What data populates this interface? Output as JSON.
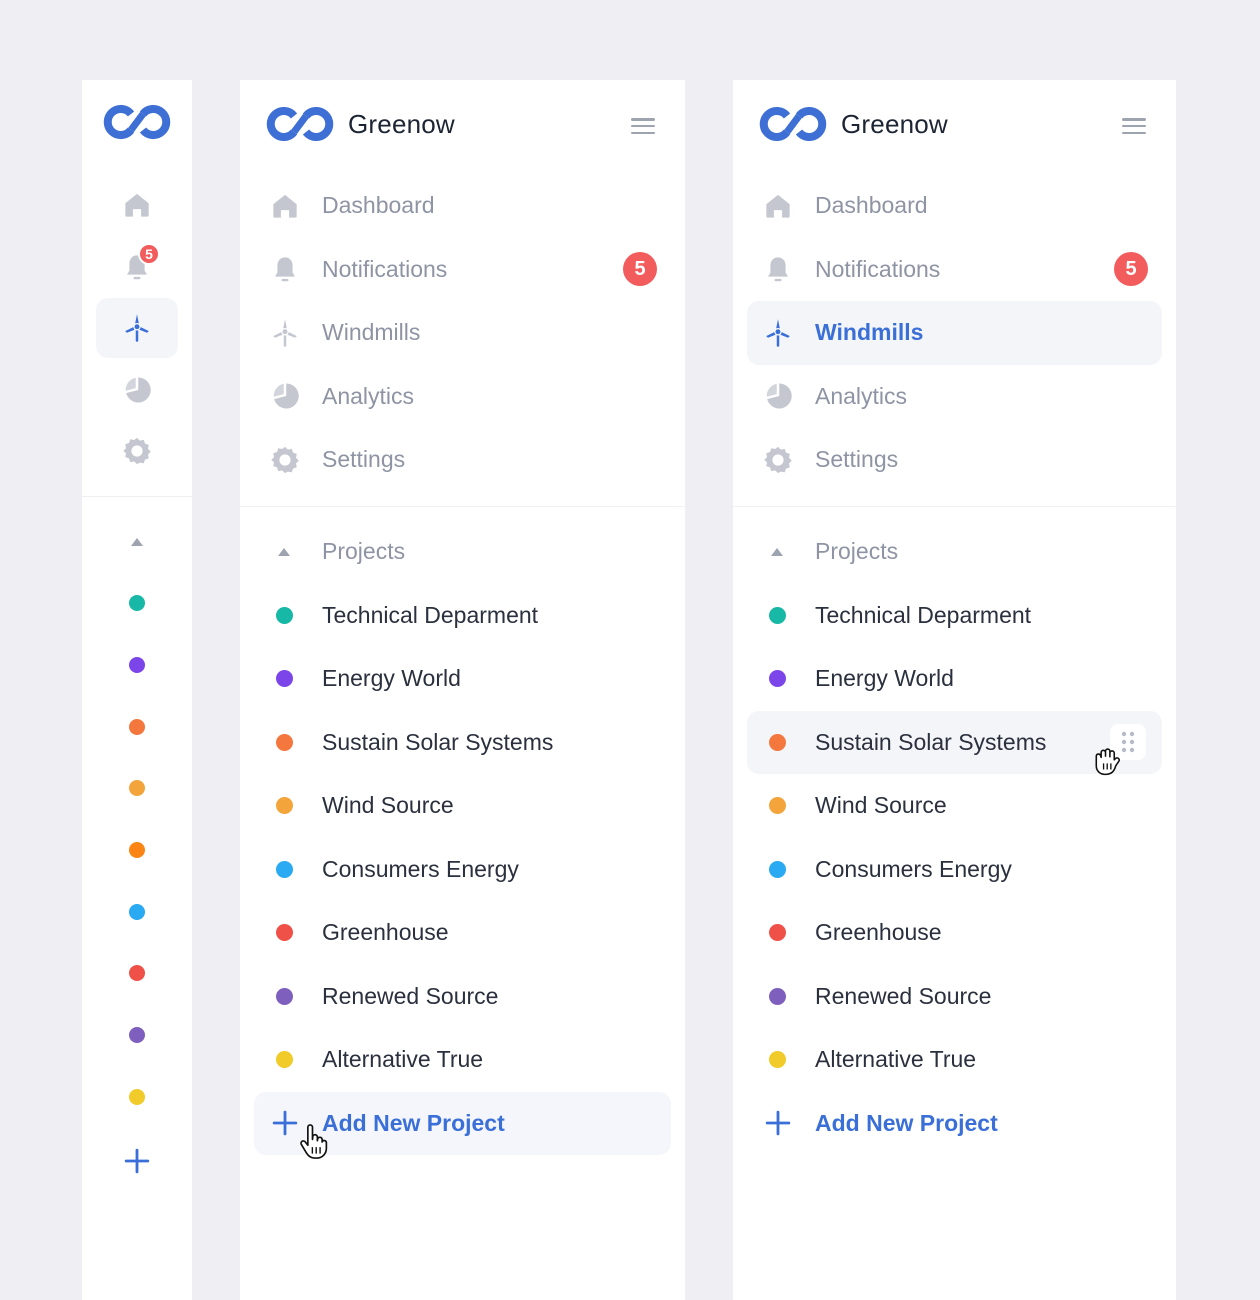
{
  "brand": {
    "name": "Greenow",
    "logo_icon": "infinity-logo-icon"
  },
  "colors": {
    "accent": "#3b6fd8",
    "badge": "#f25c5c",
    "icon_inactive": "#c4c7d0",
    "text_muted": "#8e94a3",
    "text_dark": "#2a303d"
  },
  "menu": {
    "icon": "hamburger-menu-icon"
  },
  "nav": [
    {
      "key": "dashboard",
      "label": "Dashboard",
      "icon": "home-icon"
    },
    {
      "key": "notifications",
      "label": "Notifications",
      "icon": "bell-icon",
      "badge": "5"
    },
    {
      "key": "windmills",
      "label": "Windmills",
      "icon": "windmill-icon"
    },
    {
      "key": "analytics",
      "label": "Analytics",
      "icon": "pie-chart-icon"
    },
    {
      "key": "settings",
      "label": "Settings",
      "icon": "gear-icon"
    }
  ],
  "projects": {
    "header": "Projects",
    "items": [
      {
        "label": "Technical Deparment",
        "color": "#17b8a6"
      },
      {
        "label": "Energy World",
        "color": "#7c45ea"
      },
      {
        "label": "Sustain Solar Systems",
        "color": "#f4773e"
      },
      {
        "label": "Wind Source",
        "color": "#f3a53c"
      },
      {
        "label": "Consumers Energy",
        "color": "#2aaaf2"
      },
      {
        "label": "Greenhouse",
        "color": "#ef5148"
      },
      {
        "label": "Renewed Source",
        "color": "#7f5fbd"
      },
      {
        "label": "Alternative True",
        "color": "#f0cb2a"
      }
    ],
    "add_label": "Add New Project"
  },
  "mini_sidebar": {
    "badge": "5",
    "dots": [
      "#17b8a6",
      "#7c45ea",
      "#f4773e",
      "#f3a53c",
      "#fb8514",
      "#2aaaf2",
      "#ef5148",
      "#7f5fbd",
      "#f0cb2a"
    ]
  },
  "panels": {
    "collapsed": {
      "active_nav": "windmills"
    },
    "expanded_a": {
      "active_nav": null,
      "hover": "add-new-project"
    },
    "expanded_b": {
      "active_nav": "windmills",
      "hover": "Sustain Solar Systems"
    }
  }
}
